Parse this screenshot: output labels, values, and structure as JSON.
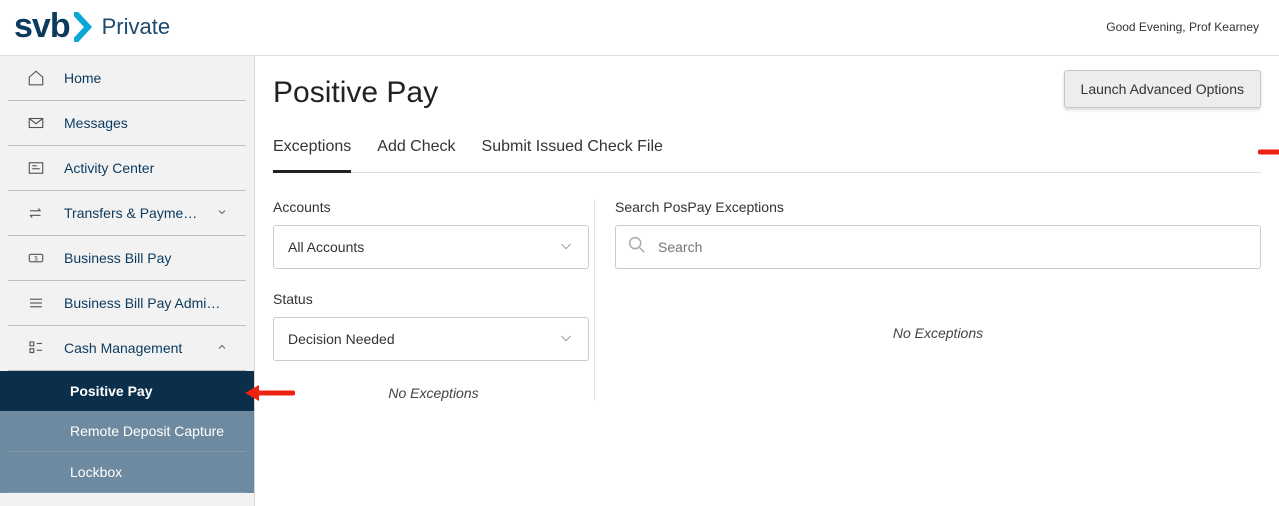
{
  "header": {
    "logo_text": "svb",
    "logo_private": "Private",
    "greeting": "Good Evening, Prof Kearney"
  },
  "sidebar": {
    "items": [
      {
        "label": "Home"
      },
      {
        "label": "Messages"
      },
      {
        "label": "Activity Center"
      },
      {
        "label": "Transfers & Payments"
      },
      {
        "label": "Business Bill Pay"
      },
      {
        "label": "Business Bill Pay Admini..."
      },
      {
        "label": "Cash Management"
      }
    ],
    "subitems": [
      {
        "label": "Positive Pay"
      },
      {
        "label": "Remote Deposit Capture"
      },
      {
        "label": "Lockbox"
      }
    ]
  },
  "page": {
    "title": "Positive Pay",
    "advanced_button": "Launch Advanced Options"
  },
  "tabs": [
    {
      "label": "Exceptions"
    },
    {
      "label": "Add Check"
    },
    {
      "label": "Submit Issued Check File"
    }
  ],
  "filters": {
    "accounts_label": "Accounts",
    "accounts_value": "All Accounts",
    "search_label": "Search PosPay Exceptions",
    "search_placeholder": "Search",
    "status_label": "Status",
    "status_value": "Decision Needed",
    "no_exceptions_left": "No Exceptions",
    "no_exceptions_right": "No Exceptions"
  }
}
